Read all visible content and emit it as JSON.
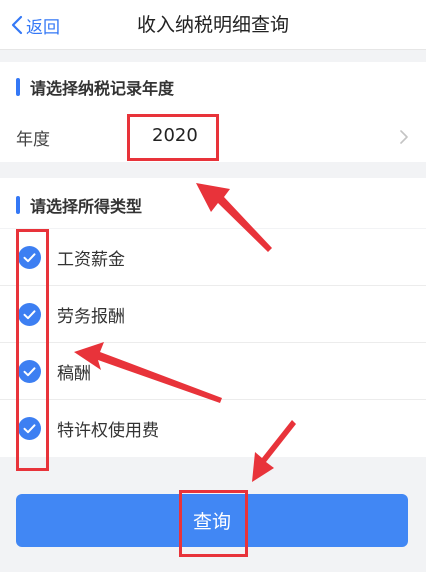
{
  "navbar": {
    "back_label": "返回",
    "title": "收入纳税明细查询"
  },
  "year_section": {
    "title": "请选择纳税记录年度",
    "field_label": "年度",
    "value": "2020"
  },
  "type_section": {
    "title": "请选择所得类型",
    "items": [
      {
        "label": "工资薪金",
        "checked": true
      },
      {
        "label": "劳务报酬",
        "checked": true
      },
      {
        "label": "稿酬",
        "checked": true
      },
      {
        "label": "特许权使用费",
        "checked": true
      }
    ]
  },
  "query_button": {
    "label": "查询"
  },
  "colors": {
    "accent": "#3478f6",
    "button": "#4187f4",
    "annotation": "#e8333a"
  }
}
